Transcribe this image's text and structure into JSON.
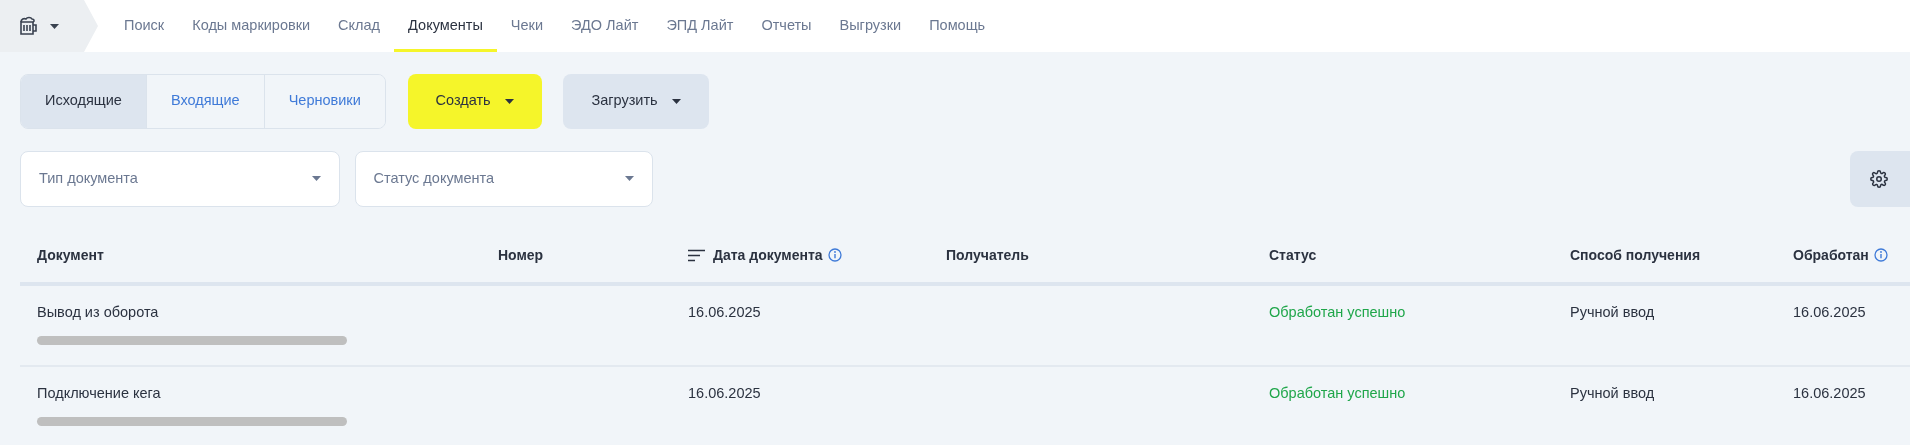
{
  "nav": {
    "items": [
      {
        "label": "Поиск",
        "selected": false
      },
      {
        "label": "Коды маркировки",
        "selected": false
      },
      {
        "label": "Склад",
        "selected": false
      },
      {
        "label": "Документы",
        "selected": true
      },
      {
        "label": "Чеки",
        "selected": false
      },
      {
        "label": "ЭДО Лайт",
        "selected": false
      },
      {
        "label": "ЭПД Лайт",
        "selected": false
      },
      {
        "label": "Отчеты",
        "selected": false
      },
      {
        "label": "Выгрузки",
        "selected": false
      },
      {
        "label": "Помощь",
        "selected": false
      }
    ]
  },
  "segments": [
    {
      "label": "Исходящие",
      "selected": true
    },
    {
      "label": "Входящие",
      "selected": false
    },
    {
      "label": "Черновики",
      "selected": false
    }
  ],
  "actions": [
    {
      "label": "Создать",
      "kind": "primary"
    },
    {
      "label": "Загрузить",
      "kind": "secondary"
    }
  ],
  "filters": [
    {
      "placeholder": "Тип документа"
    },
    {
      "placeholder": "Статус документа"
    }
  ],
  "table": {
    "columns": [
      {
        "label": "Документ",
        "sort": false,
        "info": false
      },
      {
        "label": "Номер",
        "sort": false,
        "info": false
      },
      {
        "label": "Дата документа",
        "sort": true,
        "info": true
      },
      {
        "label": "Получатель",
        "sort": false,
        "info": false
      },
      {
        "label": "Статус",
        "sort": false,
        "info": false
      },
      {
        "label": "Способ получения",
        "sort": false,
        "info": false
      },
      {
        "label": "Обработан",
        "sort": false,
        "info": true
      }
    ],
    "rows": [
      {
        "document": "Вывод из оборота",
        "date": "16.06.2025",
        "status": "Обработан успешно",
        "method": "Ручной ввод",
        "processed": "16.06.2025"
      },
      {
        "document": "Подключение кега",
        "date": "16.06.2025",
        "status": "Обработан успешно",
        "method": "Ручной ввод",
        "processed": "16.06.2025"
      }
    ]
  }
}
